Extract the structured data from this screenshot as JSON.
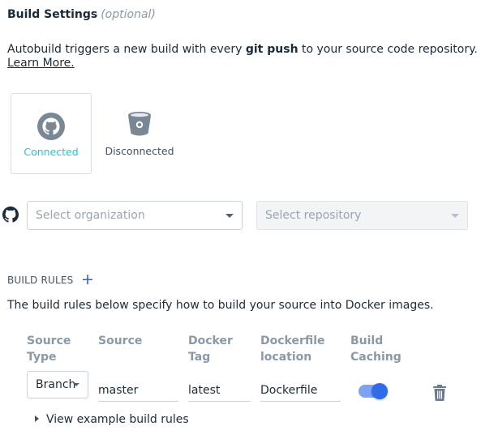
{
  "header": {
    "title": "Build Settings",
    "optional_label": "(optional)",
    "description_prefix": "Autobuild triggers a new build with every ",
    "description_bold": "git push",
    "description_suffix": " to your source code repository.",
    "learn_more": "Learn More."
  },
  "providers": [
    {
      "name": "github",
      "icon": "github-icon",
      "status": "Connected",
      "color": "#1fc6d4",
      "selected": true
    },
    {
      "name": "bitbucket",
      "icon": "bitbucket-icon",
      "status": "Disconnected",
      "color": "#45525f",
      "selected": false
    }
  ],
  "source": {
    "provider_icon": "github-icon",
    "organization_placeholder": "Select organization",
    "repository_placeholder": "Select repository",
    "repository_disabled": true
  },
  "build_rules": {
    "heading": "BUILD RULES",
    "add_icon": "plus-icon",
    "description": "The build rules below specify how to build your source into Docker images.",
    "columns": [
      {
        "line1": "Source",
        "line2": "Type"
      },
      {
        "line1": "Source",
        "line2": ""
      },
      {
        "line1": "Docker",
        "line2": "Tag"
      },
      {
        "line1": "Dockerfile",
        "line2": "location"
      },
      {
        "line1": "Build",
        "line2": "Caching"
      }
    ],
    "rule": {
      "source_type": "Branch",
      "source": "master",
      "docker_tag": "latest",
      "dockerfile_location": "Dockerfile",
      "build_caching": true,
      "delete_icon": "trash-icon"
    },
    "example_link": "View example build rules"
  },
  "colors": {
    "accent": "#2f6ce8",
    "connected": "#1fc6d4",
    "muted": "#8a98a8"
  }
}
